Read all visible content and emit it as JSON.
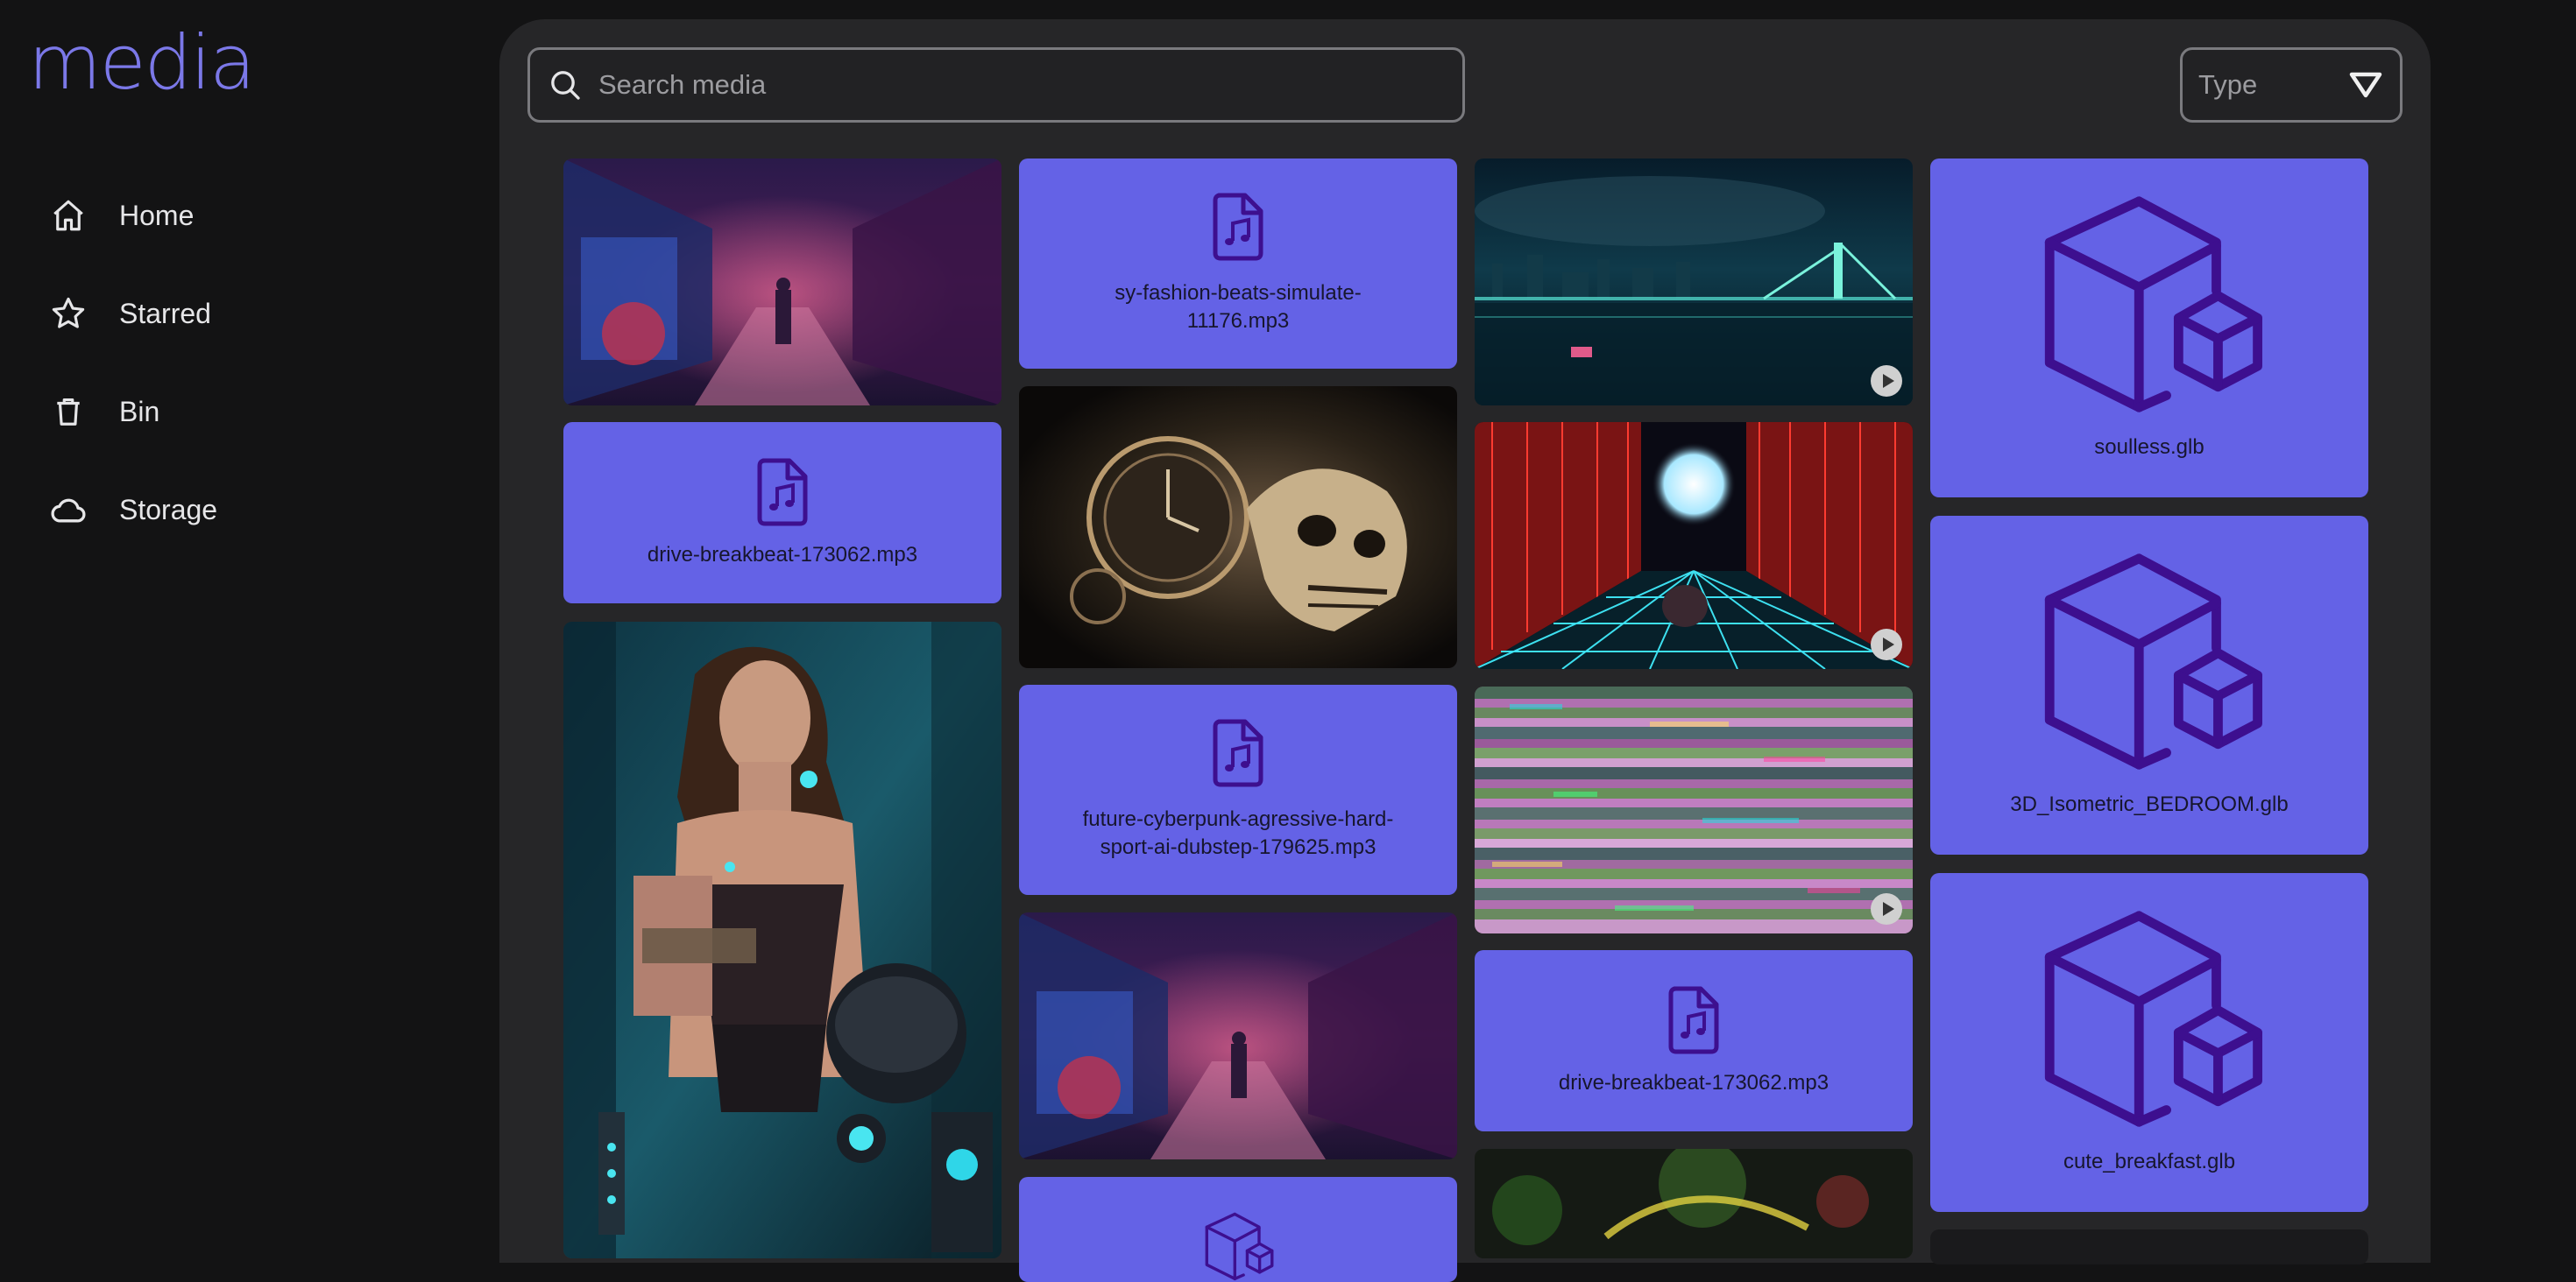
{
  "app": {
    "logo": "media"
  },
  "sidebar": {
    "items": [
      {
        "label": "Home",
        "icon": "home-icon"
      },
      {
        "label": "Starred",
        "icon": "star-icon"
      },
      {
        "label": "Bin",
        "icon": "trash-icon"
      },
      {
        "label": "Storage",
        "icon": "cloud-icon"
      }
    ]
  },
  "toolbar": {
    "search_placeholder": "Search media",
    "type_filter": "Type"
  },
  "media": {
    "items": [
      {
        "kind": "image",
        "name": "alley-neon-image"
      },
      {
        "kind": "audio",
        "name": "drive-breakbeat-173062.mp3"
      },
      {
        "kind": "image",
        "name": "cyber-woman-image"
      },
      {
        "kind": "audio",
        "name": "sy-fashion-beats-simulate-11176.mp3"
      },
      {
        "kind": "image",
        "name": "clock-skull-image"
      },
      {
        "kind": "audio",
        "name": "future-cyberpunk-agressive-hard-sport-ai-dubstep-179625.mp3"
      },
      {
        "kind": "image",
        "name": "alley-neon-image"
      },
      {
        "kind": "audio",
        "name": ""
      },
      {
        "kind": "video",
        "name": "night-city-video"
      },
      {
        "kind": "video",
        "name": "synthwave-corridor-video"
      },
      {
        "kind": "video",
        "name": "glitch-video"
      },
      {
        "kind": "audio",
        "name": "drive-breakbeat-173062.mp3"
      },
      {
        "kind": "image",
        "name": "bokeh-lights-image"
      },
      {
        "kind": "model",
        "name": "soulless.glb"
      },
      {
        "kind": "model",
        "name": "3D_Isometric_BEDROOM.glb"
      },
      {
        "kind": "model",
        "name": "cute_breakfast.glb"
      }
    ]
  },
  "colors": {
    "background": "#131314",
    "panel": "#262628",
    "accent": "#6462e6",
    "icon_dark": "#3d0f8f",
    "logo": "#7b78e8"
  }
}
